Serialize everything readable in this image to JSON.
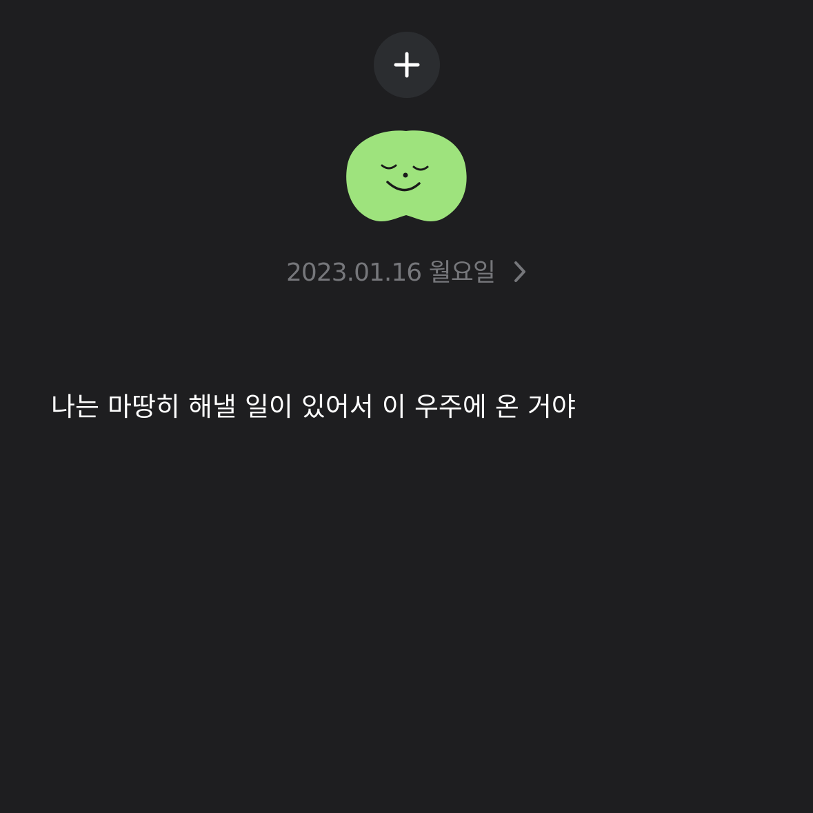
{
  "header": {
    "add_icon": "plus-icon"
  },
  "mood": {
    "icon": "smiling-green-blob-icon",
    "color": "#9ee37d"
  },
  "entry": {
    "date": "2023.01.16 월요일",
    "chevron_icon": "chevron-right-icon",
    "text": "나는 마땅히 해낼 일이 있어서 이 우주에 온 거야"
  },
  "colors": {
    "background": "#1e1e20",
    "button_bg": "#2b2d30",
    "date_text": "#76777b",
    "body_text": "#ffffff"
  }
}
